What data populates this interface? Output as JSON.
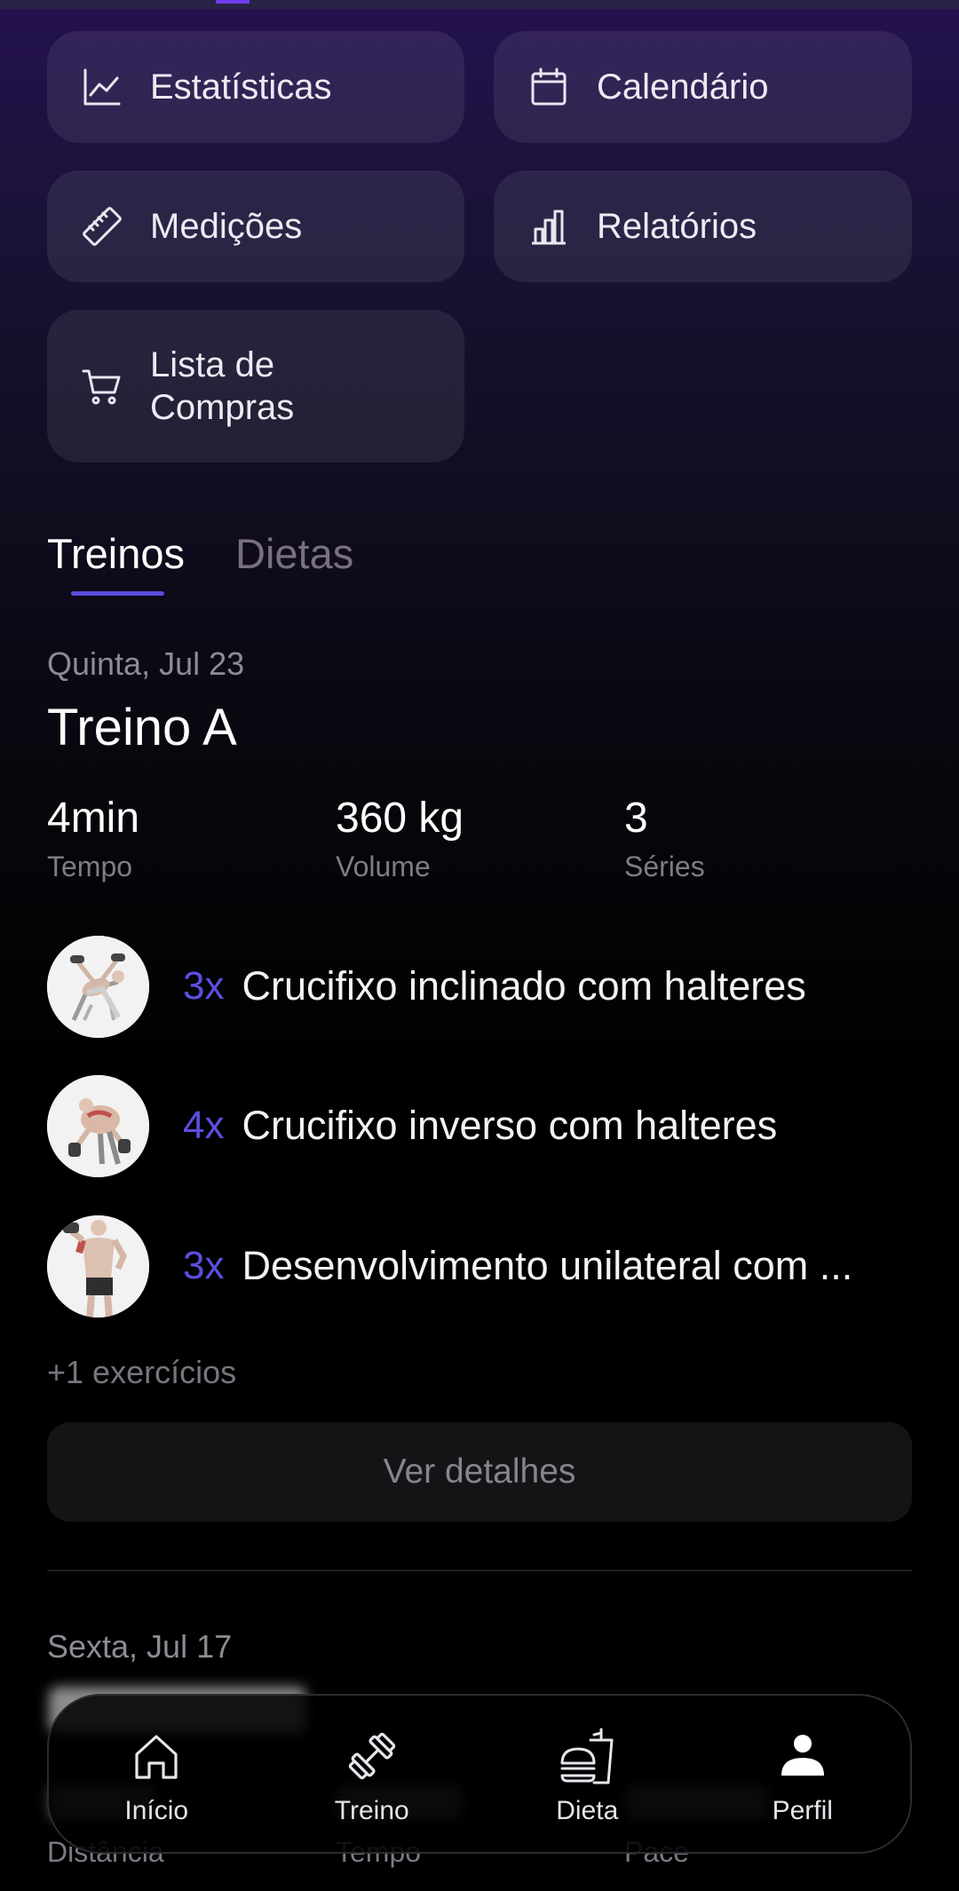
{
  "quick_actions": [
    {
      "label": "Estatísticas",
      "icon": "line-chart-icon"
    },
    {
      "label": "Calendário",
      "icon": "calendar-icon"
    },
    {
      "label": "Medições",
      "icon": "ruler-icon"
    },
    {
      "label": "Relatórios",
      "icon": "bar-chart-icon"
    },
    {
      "label_line1": "Lista de",
      "label_line2": "Compras",
      "icon": "cart-icon"
    }
  ],
  "tabs": [
    {
      "label": "Treinos",
      "active": true
    },
    {
      "label": "Dietas",
      "active": false
    }
  ],
  "workout": {
    "date": "Quinta, Jul 23",
    "title": "Treino A",
    "stats": [
      {
        "value": "4min",
        "label": "Tempo"
      },
      {
        "value": "360 kg",
        "label": "Volume"
      },
      {
        "value": "3",
        "label": "Séries"
      }
    ],
    "exercises": [
      {
        "count": "3x",
        "name": "Crucifixo inclinado com halteres"
      },
      {
        "count": "4x",
        "name": "Crucifixo inverso com halteres"
      },
      {
        "count": "3x",
        "name": "Desenvolvimento unilateral com ..."
      }
    ],
    "more": "+1 exercícios",
    "details_button": "Ver detalhes"
  },
  "next_workout": {
    "date": "Sexta, Jul 17",
    "stat_labels": [
      "Distância",
      "Tempo",
      "Pace"
    ]
  },
  "bottom_nav": [
    {
      "label": "Início",
      "icon": "home-icon"
    },
    {
      "label": "Treino",
      "icon": "dumbbell-icon"
    },
    {
      "label": "Dieta",
      "icon": "food-icon"
    },
    {
      "label": "Perfil",
      "icon": "person-icon"
    }
  ],
  "colors": {
    "accent": "#5b4fe0",
    "card_bg": "#2a2440",
    "tab_underline": "#5a4bdc"
  }
}
